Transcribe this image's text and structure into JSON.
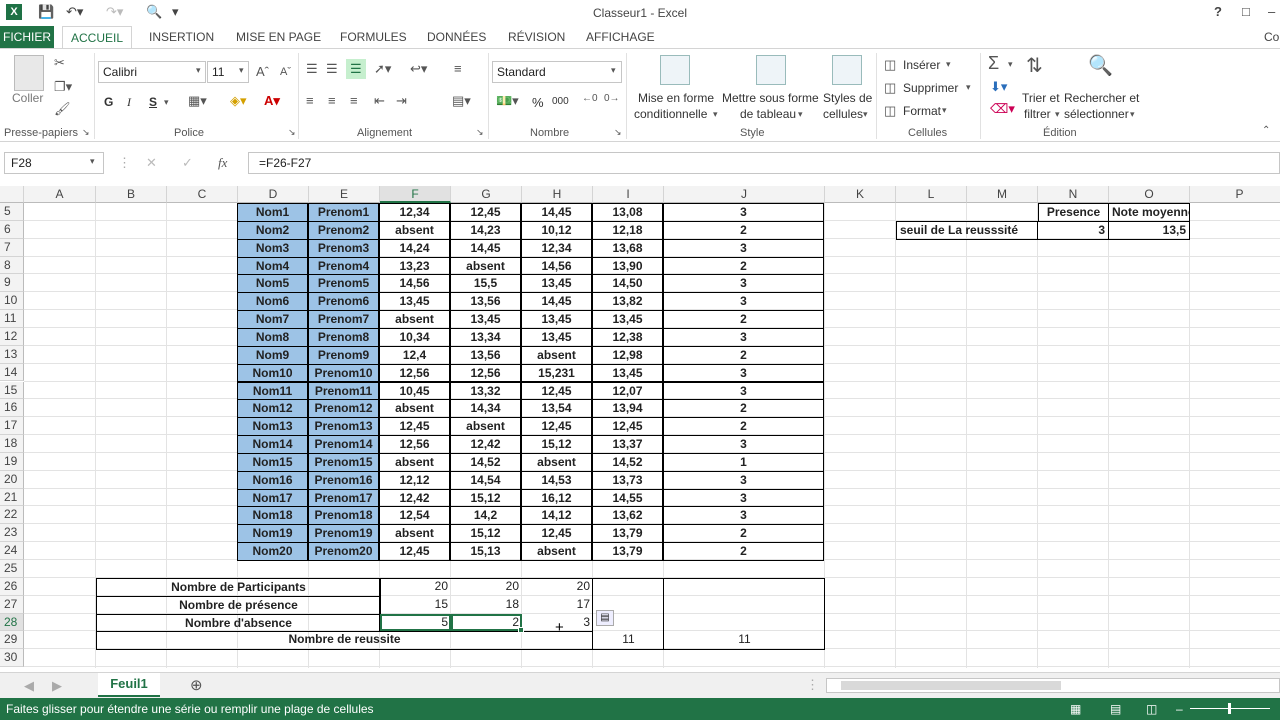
{
  "window": {
    "title": "Classeur1 - Excel",
    "help": "?",
    "account": "Con"
  },
  "tabs": [
    "FICHIER",
    "ACCUEIL",
    "INSERTION",
    "MISE EN PAGE",
    "FORMULES",
    "DONNÉES",
    "RÉVISION",
    "AFFICHAGE"
  ],
  "ribbon": {
    "paste": "Coller",
    "clipboard": "Presse-papiers",
    "font_name": "Calibri",
    "font_size": "11",
    "bold": "G",
    "italic": "I",
    "underline": "S",
    "font_group": "Police",
    "align_group": "Alignement",
    "number_format": "Standard",
    "percent": "%",
    "thousands": "000",
    "number_group": "Nombre",
    "cond_format_1": "Mise en forme",
    "cond_format_2": "conditionnelle",
    "table_format_1": "Mettre sous forme",
    "table_format_2": "de tableau",
    "cell_styles_1": "Styles de",
    "cell_styles_2": "cellules",
    "style_group": "Style",
    "insert": "Insérer",
    "delete": "Supprimer",
    "format": "Format",
    "cells_group": "Cellules",
    "sort_1": "Trier et",
    "sort_2": "filtrer",
    "find_1": "Rechercher et",
    "find_2": "sélectionner",
    "edit_group": "Édition"
  },
  "formula_bar": {
    "name_box": "F28",
    "fx": "fx",
    "formula": "=F26-F27"
  },
  "columns": [
    "A",
    "B",
    "C",
    "D",
    "E",
    "F",
    "G",
    "H",
    "I",
    "J",
    "K",
    "L",
    "M",
    "N",
    "O",
    "P"
  ],
  "rows": [
    "5",
    "6",
    "7",
    "8",
    "9",
    "10",
    "11",
    "12",
    "13",
    "14",
    "15",
    "16",
    "17",
    "18",
    "19",
    "20",
    "21",
    "22",
    "23",
    "24",
    "25",
    "26",
    "27",
    "28",
    "29",
    "30"
  ],
  "students": [
    [
      "Nom1",
      "Prenom1",
      "12,34",
      "12,45",
      "14,45",
      "13,08",
      "3"
    ],
    [
      "Nom2",
      "Prenom2",
      "absent",
      "14,23",
      "10,12",
      "12,18",
      "2"
    ],
    [
      "Nom3",
      "Prenom3",
      "14,24",
      "14,45",
      "12,34",
      "13,68",
      "3"
    ],
    [
      "Nom4",
      "Prenom4",
      "13,23",
      "absent",
      "14,56",
      "13,90",
      "2"
    ],
    [
      "Nom5",
      "Prenom5",
      "14,56",
      "15,5",
      "13,45",
      "14,50",
      "3"
    ],
    [
      "Nom6",
      "Prenom6",
      "13,45",
      "13,56",
      "14,45",
      "13,82",
      "3"
    ],
    [
      "Nom7",
      "Prenom7",
      "absent",
      "13,45",
      "13,45",
      "13,45",
      "2"
    ],
    [
      "Nom8",
      "Prenom8",
      "10,34",
      "13,34",
      "13,45",
      "12,38",
      "3"
    ],
    [
      "Nom9",
      "Prenom9",
      "12,4",
      "13,56",
      "absent",
      "12,98",
      "2"
    ],
    [
      "Nom10",
      "Prenom10",
      "12,56",
      "12,56",
      "15,231",
      "13,45",
      "3"
    ],
    [
      "Nom11",
      "Prenom11",
      "10,45",
      "13,32",
      "12,45",
      "12,07",
      "3"
    ],
    [
      "Nom12",
      "Prenom12",
      "absent",
      "14,34",
      "13,54",
      "13,94",
      "2"
    ],
    [
      "Nom13",
      "Prenom13",
      "12,45",
      "absent",
      "12,45",
      "12,45",
      "2"
    ],
    [
      "Nom14",
      "Prenom14",
      "12,56",
      "12,42",
      "15,12",
      "13,37",
      "3"
    ],
    [
      "Nom15",
      "Prenom15",
      "absent",
      "14,52",
      "absent",
      "14,52",
      "1"
    ],
    [
      "Nom16",
      "Prenom16",
      "12,12",
      "14,54",
      "14,53",
      "13,73",
      "3"
    ],
    [
      "Nom17",
      "Prenom17",
      "12,42",
      "15,12",
      "16,12",
      "14,55",
      "3"
    ],
    [
      "Nom18",
      "Prenom18",
      "12,54",
      "14,2",
      "14,12",
      "13,62",
      "3"
    ],
    [
      "Nom19",
      "Prenom19",
      "absent",
      "15,12",
      "12,45",
      "13,79",
      "2"
    ],
    [
      "Nom20",
      "Prenom20",
      "12,45",
      "15,13",
      "absent",
      "13,79",
      "2"
    ]
  ],
  "side_table": {
    "presence_label": "Presence",
    "avg_label": "Note moyenne",
    "threshold_label": "seuil de La reusssité",
    "presence_value": "3",
    "avg_value": "13,5"
  },
  "summary": {
    "participants_label": "Nombre de Participants",
    "participants": [
      "20",
      "20",
      "20"
    ],
    "presence_label": "Nombre de présence",
    "presence": [
      "15",
      "18",
      "17"
    ],
    "absence_label": "Nombre d'absence",
    "absence": [
      "5",
      "2",
      "3"
    ],
    "success_label": "Nombre de reussite",
    "success_i": "11",
    "success_j": "11"
  },
  "sheet_tab": "Feuil1",
  "status": "Faites glisser pour étendre une série ou remplir une plage de cellules"
}
